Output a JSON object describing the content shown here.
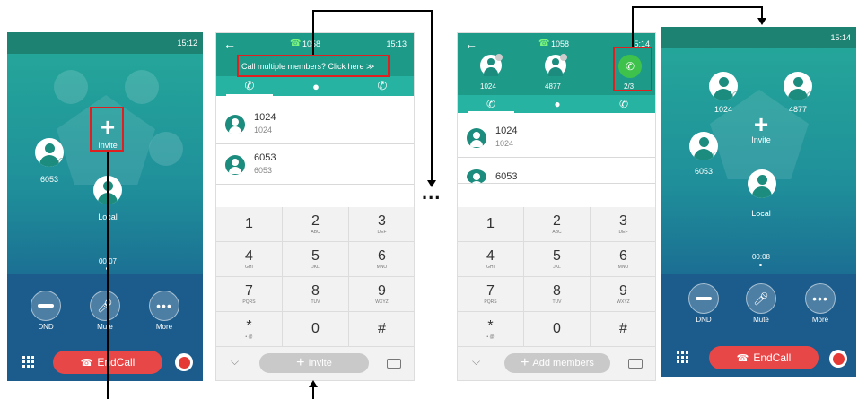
{
  "screen1": {
    "time": "15:12",
    "invite_label": "Invite",
    "participant": "6053",
    "local_label": "Local",
    "duration": "00:07",
    "controls": {
      "dnd": "DND",
      "mute": "Mute",
      "more": "More"
    },
    "endcall_label": "EndCall"
  },
  "screen2": {
    "line": "1058",
    "time": "15:13",
    "banner": "Call multiple members? Click here  ≫",
    "contacts": [
      {
        "name": "1024",
        "number": "1024"
      },
      {
        "name": "6053",
        "number": "6053"
      }
    ],
    "invite_button": "Invite"
  },
  "ellipsis": "...",
  "screen3": {
    "line": "1058",
    "time": "5:14",
    "members": [
      "1024",
      "4877"
    ],
    "count": "2/3",
    "contacts": [
      {
        "name": "1024",
        "number": "1024"
      },
      {
        "name": "6053",
        "number": ""
      }
    ],
    "add_button": "Add members"
  },
  "screen4": {
    "time": "15:14",
    "invite_label": "Invite",
    "participants": [
      "1024",
      "4877",
      "6053"
    ],
    "local_label": "Local",
    "duration": "00:08",
    "controls": {
      "dnd": "DND",
      "mute": "Mute",
      "more": "More"
    },
    "endcall_label": "EndCall"
  },
  "keys": [
    {
      "d": "1",
      "l": ""
    },
    {
      "d": "2",
      "l": "ABC"
    },
    {
      "d": "3",
      "l": "DEF"
    },
    {
      "d": "4",
      "l": "GHI"
    },
    {
      "d": "5",
      "l": "JKL"
    },
    {
      "d": "6",
      "l": "MNO"
    },
    {
      "d": "7",
      "l": "PQRS"
    },
    {
      "d": "8",
      "l": "TUV"
    },
    {
      "d": "9",
      "l": "WXYZ"
    },
    {
      "d": "*",
      "l": "• @"
    },
    {
      "d": "0",
      "l": ""
    },
    {
      "d": "#",
      "l": ""
    }
  ],
  "colors": {
    "accent": "#1e9a89",
    "endcall": "#e84748",
    "highlight": "#e02020"
  }
}
